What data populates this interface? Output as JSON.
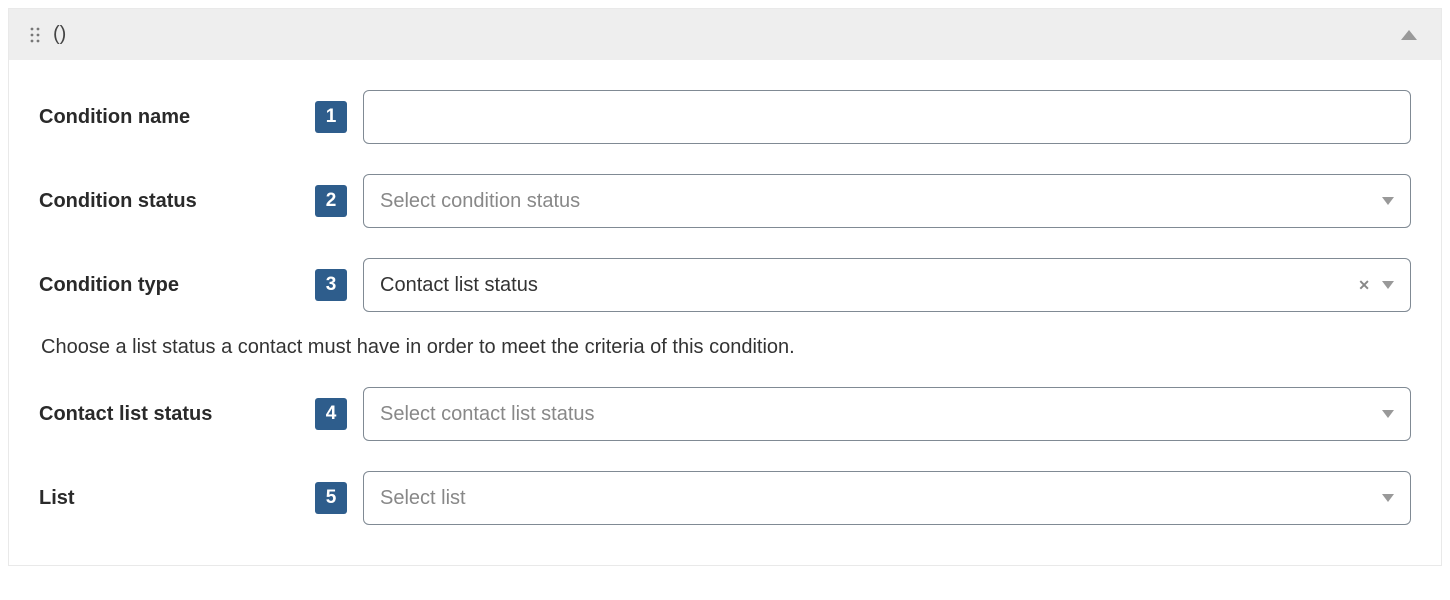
{
  "header": {
    "title": "()"
  },
  "rows": {
    "condition_name": {
      "label": "Condition name",
      "step": "1",
      "value": ""
    },
    "condition_status": {
      "label": "Condition status",
      "step": "2",
      "placeholder": "Select condition status"
    },
    "condition_type": {
      "label": "Condition type",
      "step": "3",
      "value": "Contact list status"
    },
    "helper": "Choose a list status a contact must have in order to meet the criteria of this condition.",
    "contact_list_status": {
      "label": "Contact list status",
      "step": "4",
      "placeholder": "Select contact list status"
    },
    "list": {
      "label": "List",
      "step": "5",
      "placeholder": "Select list"
    }
  }
}
